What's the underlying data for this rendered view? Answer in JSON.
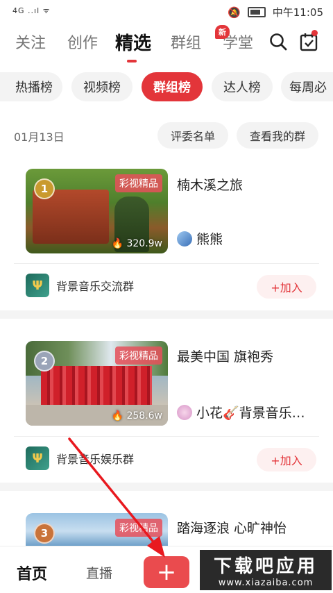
{
  "status": {
    "left": "4G ..ıl ᯤ",
    "time": "中午11:05"
  },
  "top_tabs": [
    {
      "label": "关注"
    },
    {
      "label": "创作"
    },
    {
      "label": "精选",
      "active": true
    },
    {
      "label": "群组"
    },
    {
      "label": "学堂",
      "badge": "新"
    }
  ],
  "chips": [
    {
      "label": "热播榜"
    },
    {
      "label": "视频榜"
    },
    {
      "label": "群组榜",
      "active": true
    },
    {
      "label": "达人榜"
    },
    {
      "label": "每周必"
    }
  ],
  "date": "01月13日",
  "pills": {
    "judges": "评委名单",
    "my_group": "查看我的群"
  },
  "cards": [
    {
      "rank": "1",
      "tag": "彩视精品",
      "count": "320.9w",
      "title": "楠木溪之旅",
      "author": "熊熊",
      "group": "背景音乐交流群",
      "join": "+加入"
    },
    {
      "rank": "2",
      "tag": "彩视精品",
      "count": "258.6w",
      "title": "最美中国  旗袍秀",
      "author": "小花🎸背景音乐…",
      "group": "背景音乐娱乐群",
      "join": "+加入"
    },
    {
      "rank": "3",
      "tag": "彩视精品",
      "title": "踏海逐浪  心旷神怡"
    }
  ],
  "bottom_nav": {
    "home": "首页",
    "live": "直播",
    "plus": "+"
  },
  "watermark": {
    "big": "下载吧应用",
    "small": "www.xiazaiba.com"
  },
  "colors": {
    "accent": "#e3353a"
  }
}
